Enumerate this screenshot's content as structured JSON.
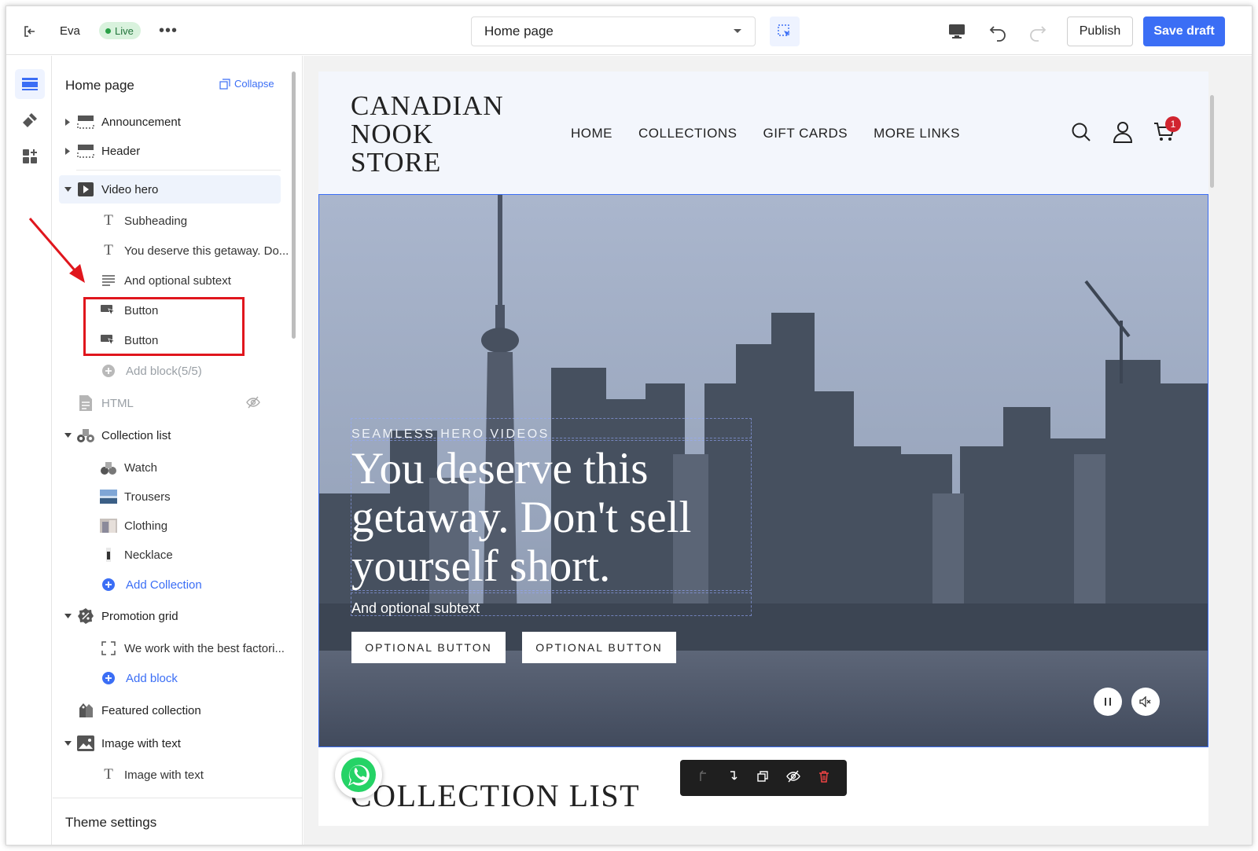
{
  "topbar": {
    "store_name": "Eva",
    "status_badge": "Live",
    "more_label": "•••",
    "page_selector_value": "Home page",
    "publish_label": "Publish",
    "save_draft_label": "Save draft"
  },
  "rail": {
    "items": [
      "sections-icon",
      "theme-style-icon",
      "apps-icon"
    ]
  },
  "sidebar": {
    "title": "Home page",
    "collapse_label": "Collapse",
    "sections": [
      {
        "label": "Announcement",
        "icon": "announcement-icon"
      },
      {
        "label": "Header",
        "icon": "header-icon"
      },
      {
        "label": "Video hero",
        "icon": "video-icon"
      },
      {
        "label": "Subheading",
        "icon": "text-icon"
      },
      {
        "label": "You deserve this getaway. Do...",
        "icon": "text-icon"
      },
      {
        "label": "And optional subtext",
        "icon": "paragraph-icon"
      },
      {
        "label": "Button",
        "icon": "button-icon"
      },
      {
        "label": "Button",
        "icon": "button-icon"
      },
      {
        "label": "Add block(5/5)",
        "icon": "add-icon"
      },
      {
        "label": "HTML",
        "icon": "html-icon"
      },
      {
        "label": "Collection list",
        "icon": "collection-list-icon"
      },
      {
        "label": "Watch",
        "icon": "collection-thumb"
      },
      {
        "label": "Trousers",
        "icon": "collection-thumb"
      },
      {
        "label": "Clothing",
        "icon": "collection-thumb"
      },
      {
        "label": "Necklace",
        "icon": "collection-thumb"
      },
      {
        "label": "Add Collection",
        "icon": "add-icon"
      },
      {
        "label": "Promotion grid",
        "icon": "promotion-icon"
      },
      {
        "label": "We work with the best factori...",
        "icon": "frame-icon"
      },
      {
        "label": "Add block",
        "icon": "add-icon"
      },
      {
        "label": "Featured collection",
        "icon": "featured-collection-icon"
      },
      {
        "label": "Image with text",
        "icon": "image-icon"
      },
      {
        "label": "Image with text",
        "icon": "text-icon"
      }
    ],
    "footer_label": "Theme settings"
  },
  "preview": {
    "logo": [
      "CANADIAN",
      "NOOK",
      "STORE"
    ],
    "nav": [
      "HOME",
      "COLLECTIONS",
      "GIFT CARDS",
      "MORE LINKS"
    ],
    "cart_count": "1",
    "hero": {
      "subheading": "SEAMLESS HERO VIDEOS",
      "title": "You deserve this getaway. Don't sell yourself short.",
      "subtext": "And optional subtext",
      "button_1": "OPTIONAL BUTTON",
      "button_2": "OPTIONAL BUTTON"
    },
    "next_section_heading": "COLLECTION LIST"
  },
  "colors": {
    "accent": "#3b6ef5",
    "live_bg": "#d9f2dd",
    "annotation": "#e0161d"
  }
}
